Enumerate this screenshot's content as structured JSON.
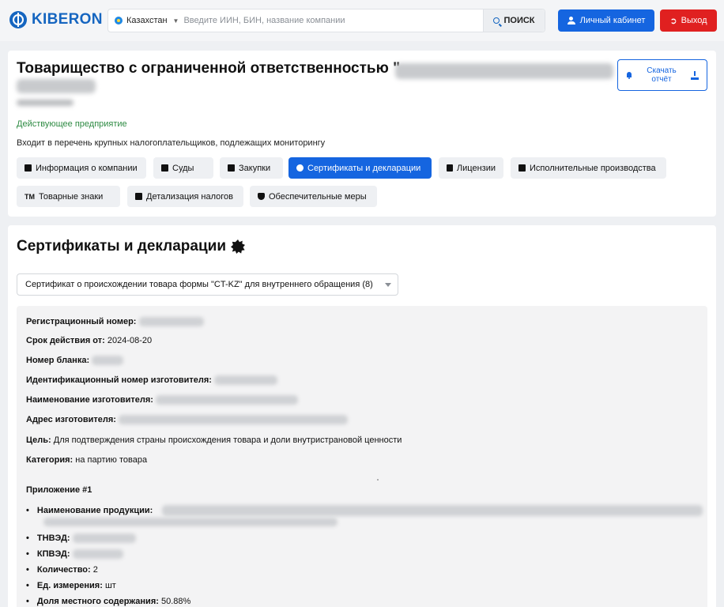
{
  "header": {
    "logo": "KIBERON",
    "country": "Казахстан",
    "search_placeholder": "Введите ИИН, БИН, название компании",
    "search_button": "ПОИСК",
    "cabinet_button": "Личный кабинет",
    "exit_button": "Выход",
    "colors": {
      "brand": "#1565c0",
      "primary": "#1565e0",
      "danger": "#e02020",
      "status_green": "#2e8b43"
    }
  },
  "company": {
    "title": "Товарищество с ограниченной ответственностью \"",
    "status": "Действующее предприятие",
    "note": "Входит в перечень крупных налогоплательщиков, подлежащих мониторингу",
    "download_button": "Скачать отчёт",
    "tabs": [
      {
        "label": "Информация о компании",
        "icon": "building-icon"
      },
      {
        "label": "Суды",
        "icon": "scales-icon"
      },
      {
        "label": "Закупки",
        "icon": "handshake-icon"
      },
      {
        "label": "Сертификаты и декларации",
        "icon": "certificate-icon"
      },
      {
        "label": "Лицензии",
        "icon": "file-icon"
      },
      {
        "label": "Исполнительные производства",
        "icon": "gavel-icon"
      },
      {
        "label": "Товарные знаки",
        "icon": "trademark-icon"
      },
      {
        "label": "Детализация налогов",
        "icon": "coins-icon"
      },
      {
        "label": "Обеспечительные меры",
        "icon": "shield-icon"
      }
    ],
    "active_tab": "Сертификаты и декларации"
  },
  "certificates": {
    "title": "Сертификаты и декларации",
    "selected": "Сертификат о происхождении товара формы \"CT-KZ\" для внутреннего обращения (8)",
    "fields": {
      "reg_number_label": "Регистрационный номер:",
      "valid_from_label": "Срок действия от:",
      "valid_from_value": "2024-08-20",
      "blank_label": "Номер бланка:",
      "manufacturer_id_label": "Идентификационный номер изготовителя:",
      "manufacturer_name_label": "Наименование изготовителя:",
      "manufacturer_address_label": "Адрес изготовителя:",
      "purpose_label": "Цель:",
      "purpose_value": "Для подтверждения страны происхождения товара и доли внутристрановой ценности",
      "category_label": "Категория:",
      "category_value": "на партию товара"
    },
    "appendix": {
      "title": "Приложение #1",
      "product_label": "Наименование продукции:",
      "tnved_label": "ТНВЭД:",
      "kpved_label": "КПВЭД:",
      "quantity_label": "Количество:",
      "quantity_value": "2",
      "unit_label": "Ед. измерения:",
      "unit_value": "шт",
      "local_share_label": "Доля местного содержания:",
      "local_share_value": "50.88%"
    }
  }
}
